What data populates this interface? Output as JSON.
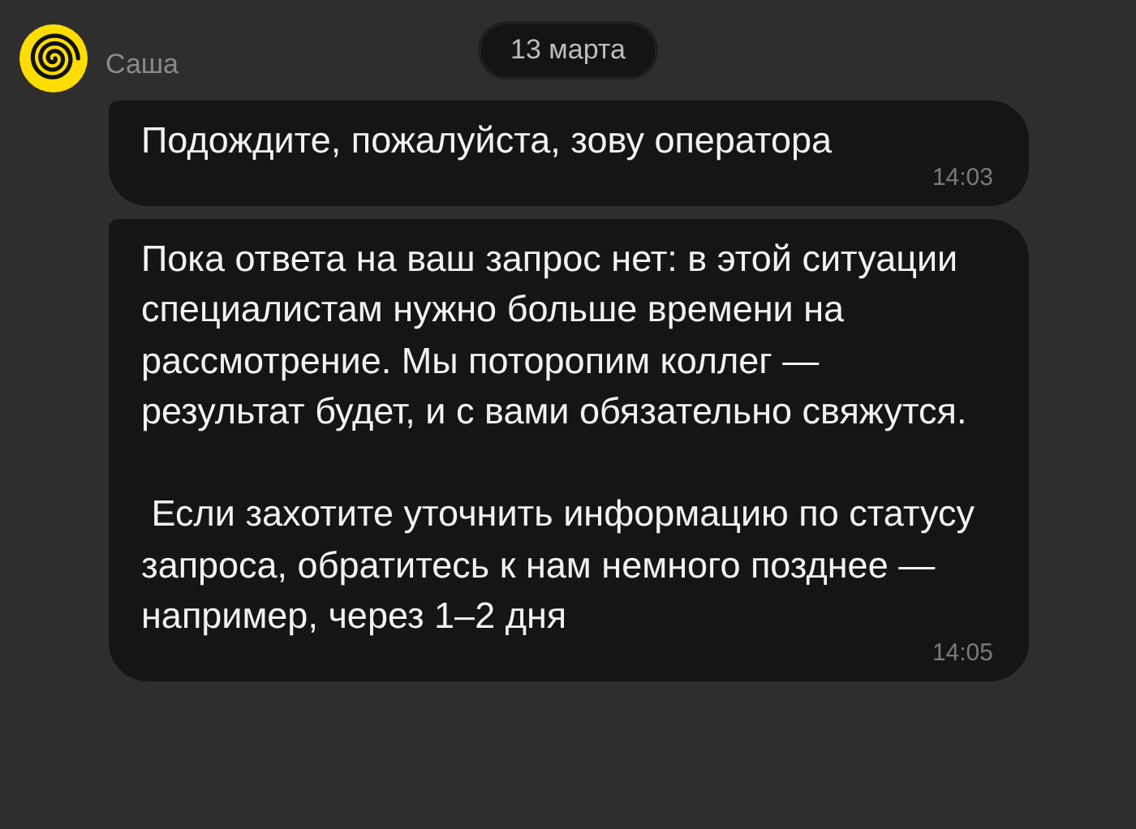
{
  "date_label": "13 марта",
  "sender": {
    "name": "Саша"
  },
  "messages": [
    {
      "text": "Подождите, пожалуйста, зову оператора",
      "time": "14:03"
    },
    {
      "text": "Пока ответа на ваш запрос нет: в этой ситуации специалистам нужно больше времени на рассмотрение. Мы поторопим коллег — результат будет, и с вами обязательно свяжутся.\n\n Если захотите уточнить информацию по статусу запроса, обратитесь к нам немного позднее — например, через 1–2 дня",
      "time": "14:05"
    }
  ]
}
